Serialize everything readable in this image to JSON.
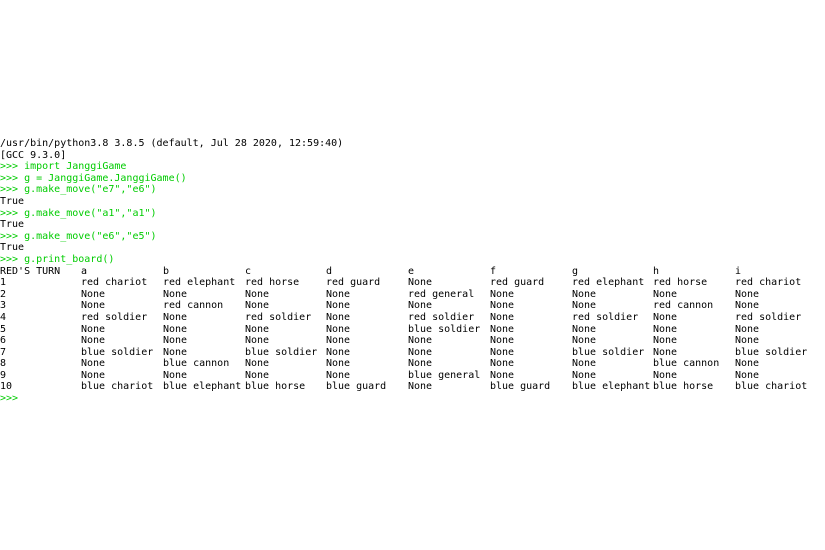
{
  "console": {
    "header_lines": [
      "/usr/bin/python3.8 3.8.5 (default, Jul 28 2020, 12:59:40)",
      "[GCC 9.3.0]"
    ],
    "history": [
      {
        "kind": "prompt",
        "text": ">>> import JanggiGame"
      },
      {
        "kind": "prompt",
        "text": ">>> g = JanggiGame.JanggiGame()"
      },
      {
        "kind": "prompt",
        "text": ">>> g.make_move(\"e7\",\"e6\")"
      },
      {
        "kind": "output",
        "text": "True"
      },
      {
        "kind": "prompt",
        "text": ">>> g.make_move(\"a1\",\"a1\")"
      },
      {
        "kind": "output",
        "text": "True"
      },
      {
        "kind": "prompt",
        "text": ">>> g.make_move(\"e6\",\"e5\")"
      },
      {
        "kind": "output",
        "text": "True"
      },
      {
        "kind": "prompt",
        "text": ">>> g.print_board()"
      }
    ],
    "colors": {
      "prompt": "#00cc00",
      "output": "#000000",
      "background": "#ffffff"
    }
  },
  "board": {
    "turn_label": "RED'S TURN",
    "columns": [
      "a",
      "b",
      "c",
      "d",
      "e",
      "f",
      "g",
      "h",
      "i"
    ],
    "rows": [
      {
        "num": "1",
        "cells": [
          "red chariot",
          "red elephant",
          "red horse",
          "red guard",
          "None",
          "red guard",
          "red elephant",
          "red horse",
          "red chariot"
        ]
      },
      {
        "num": "2",
        "cells": [
          "None",
          "None",
          "None",
          "None",
          "red general",
          "None",
          "None",
          "None",
          "None"
        ]
      },
      {
        "num": "3",
        "cells": [
          "None",
          "red cannon",
          "None",
          "None",
          "None",
          "None",
          "None",
          "red cannon",
          "None"
        ]
      },
      {
        "num": "4",
        "cells": [
          "red soldier",
          "None",
          "red soldier",
          "None",
          "red soldier",
          "None",
          "red soldier",
          "None",
          "red soldier"
        ]
      },
      {
        "num": "5",
        "cells": [
          "None",
          "None",
          "None",
          "None",
          "blue soldier",
          "None",
          "None",
          "None",
          "None"
        ]
      },
      {
        "num": "6",
        "cells": [
          "None",
          "None",
          "None",
          "None",
          "None",
          "None",
          "None",
          "None",
          "None"
        ]
      },
      {
        "num": "7",
        "cells": [
          "blue soldier",
          "None",
          "blue soldier",
          "None",
          "None",
          "None",
          "blue soldier",
          "None",
          "blue soldier"
        ]
      },
      {
        "num": "8",
        "cells": [
          "None",
          "blue cannon",
          "None",
          "None",
          "None",
          "None",
          "None",
          "blue cannon",
          "None"
        ]
      },
      {
        "num": "9",
        "cells": [
          "None",
          "None",
          "None",
          "None",
          "blue general",
          "None",
          "None",
          "None",
          "None"
        ]
      },
      {
        "num": "10",
        "cells": [
          "blue chariot",
          "blue elephant",
          "blue horse",
          "blue guard",
          "None",
          "blue guard",
          "blue elephant",
          "blue horse",
          "blue chariot"
        ]
      }
    ]
  },
  "final_prompt": ">>>"
}
